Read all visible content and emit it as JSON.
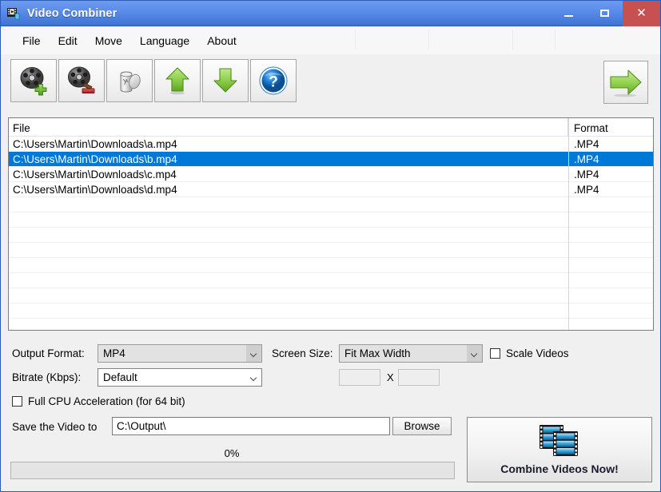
{
  "window": {
    "title": "Video Combiner",
    "app_icon": "video-film-icon",
    "minimize_label": "Minimize",
    "maximize_label": "Maximize",
    "close_label": "Close",
    "accent_color": "#4176d6",
    "close_color": "#c75050"
  },
  "menu": {
    "items": [
      {
        "label": "File"
      },
      {
        "label": "Edit"
      },
      {
        "label": "Move"
      },
      {
        "label": "Language"
      },
      {
        "label": "About"
      }
    ]
  },
  "toolbar": {
    "buttons": [
      {
        "name": "add-video-button",
        "icon": "film-reel-add-icon",
        "tip": "Add Video"
      },
      {
        "name": "remove-video-button",
        "icon": "film-reel-remove-icon",
        "tip": "Remove Video"
      },
      {
        "name": "clear-list-button",
        "icon": "recycle-bin-icon",
        "tip": "Clear List"
      },
      {
        "name": "move-up-button",
        "icon": "arrow-up-icon",
        "tip": "Move Up"
      },
      {
        "name": "move-down-button",
        "icon": "arrow-down-icon",
        "tip": "Move Down"
      },
      {
        "name": "help-button",
        "icon": "help-question-icon",
        "tip": "Help"
      }
    ],
    "go_button": {
      "name": "go-button",
      "icon": "arrow-right-icon",
      "tip": "Go"
    }
  },
  "file_list": {
    "columns": [
      "File",
      "Format"
    ],
    "rows": [
      {
        "file": "C:\\Users\\Martin\\Downloads\\a.mp4",
        "format": ".MP4",
        "selected": false
      },
      {
        "file": "C:\\Users\\Martin\\Downloads\\b.mp4",
        "format": ".MP4",
        "selected": true
      },
      {
        "file": "C:\\Users\\Martin\\Downloads\\c.mp4",
        "format": ".MP4",
        "selected": false
      },
      {
        "file": "C:\\Users\\Martin\\Downloads\\d.mp4",
        "format": ".MP4",
        "selected": false
      }
    ],
    "selection_color": "#0078d7"
  },
  "settings": {
    "output_format_label": "Output Format:",
    "output_format_value": "MP4",
    "output_format_disabled": true,
    "bitrate_label": "Bitrate (Kbps):",
    "bitrate_value": "Default",
    "bitrate_disabled": false,
    "screen_size_label": "Screen Size:",
    "screen_size_value": "Fit Max Width",
    "screen_size_disabled": true,
    "scale_videos_label": "Scale Videos",
    "scale_videos_checked": false,
    "width_value": "",
    "height_value": "",
    "dimension_separator": "X",
    "full_cpu_label": "Full CPU Acceleration (for 64 bit)",
    "full_cpu_checked": false
  },
  "output": {
    "save_label": "Save the Video to",
    "path_value": "C:\\Output\\",
    "browse_label": "Browse"
  },
  "progress": {
    "percent_text": "0%",
    "value": 0
  },
  "action": {
    "combine_label": "Combine Videos Now!",
    "combine_icon": "film-strips-icon"
  }
}
